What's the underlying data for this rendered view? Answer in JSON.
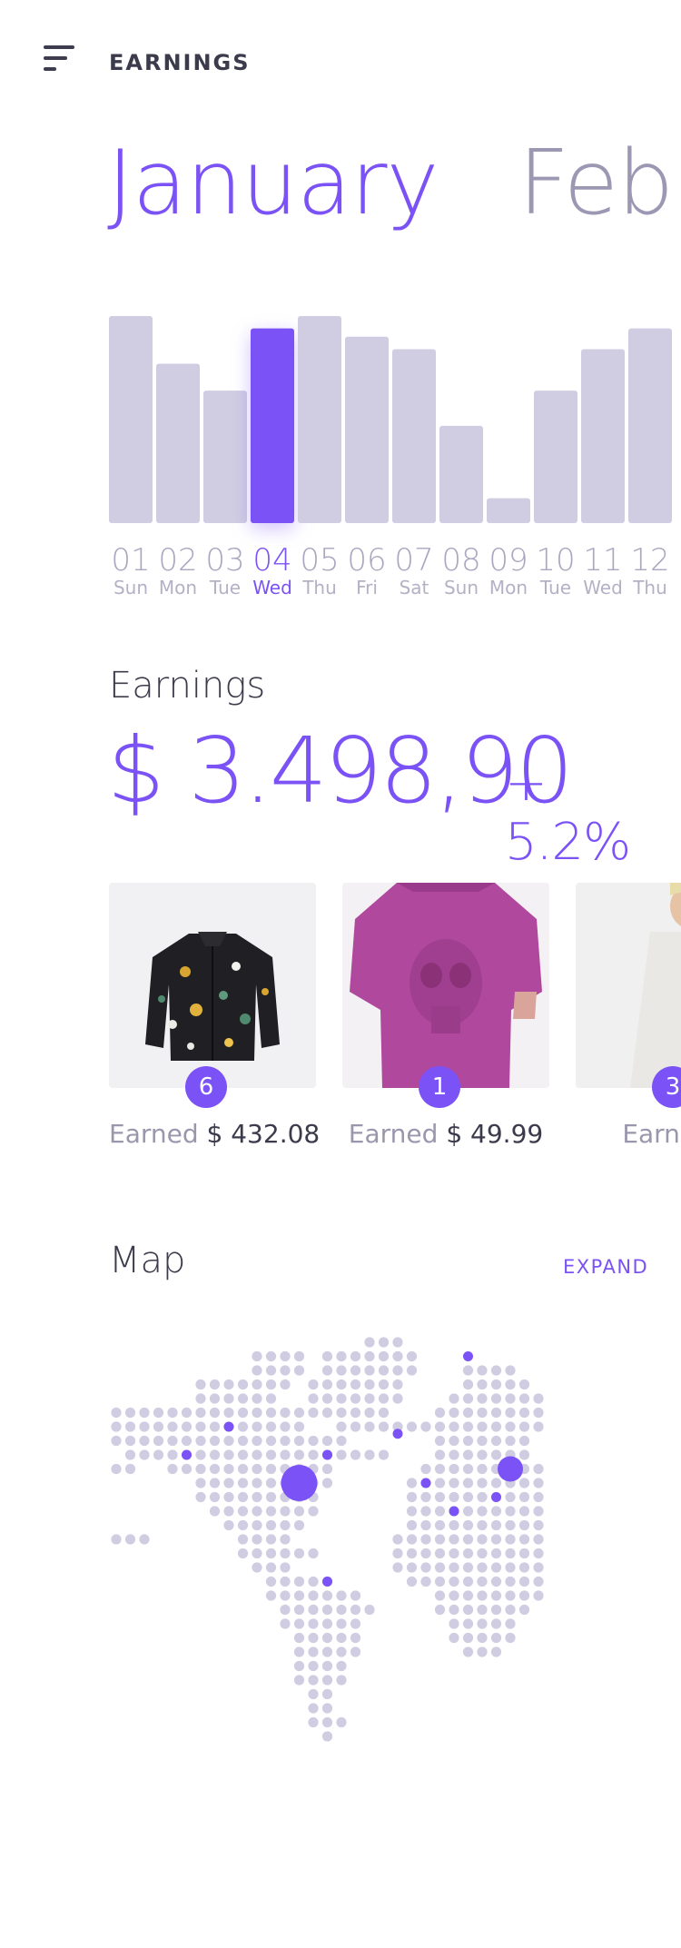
{
  "header": {
    "title": "EARNINGS"
  },
  "months": [
    "January",
    "Februar"
  ],
  "chart_data": {
    "type": "bar",
    "categories": [
      "01",
      "02",
      "03",
      "04",
      "05",
      "06",
      "07",
      "08",
      "09",
      "10",
      "11",
      "12"
    ],
    "weekdays": [
      "Sun",
      "Mon",
      "Tue",
      "Wed",
      "Thu",
      "Fri",
      "Sat",
      "Sun",
      "Mon",
      "Tue",
      "Wed",
      "Thu"
    ],
    "values": [
      100,
      77,
      64,
      94,
      100,
      90,
      84,
      47,
      12,
      64,
      84,
      94
    ],
    "highlight_index": 3,
    "colors": {
      "bar": "#d0cde2",
      "highlight": "#7b52f5"
    }
  },
  "earnings": {
    "label": "Earnings",
    "amount": "$ 3.498,90",
    "change": "+ 5.2%"
  },
  "products": [
    {
      "count": "6",
      "earned_label": "Earned",
      "earned_amount": "$ 432.08"
    },
    {
      "count": "1",
      "earned_label": "Earned",
      "earned_amount": "$ 49.99"
    },
    {
      "count": "3",
      "earned_label": "Earned",
      "earned_amount": "$"
    }
  ],
  "map": {
    "title": "Map",
    "expand_label": "EXPAND"
  },
  "colors": {
    "accent": "#7b52f5",
    "muted": "#d0cde2",
    "text": "#3b3b4c"
  }
}
